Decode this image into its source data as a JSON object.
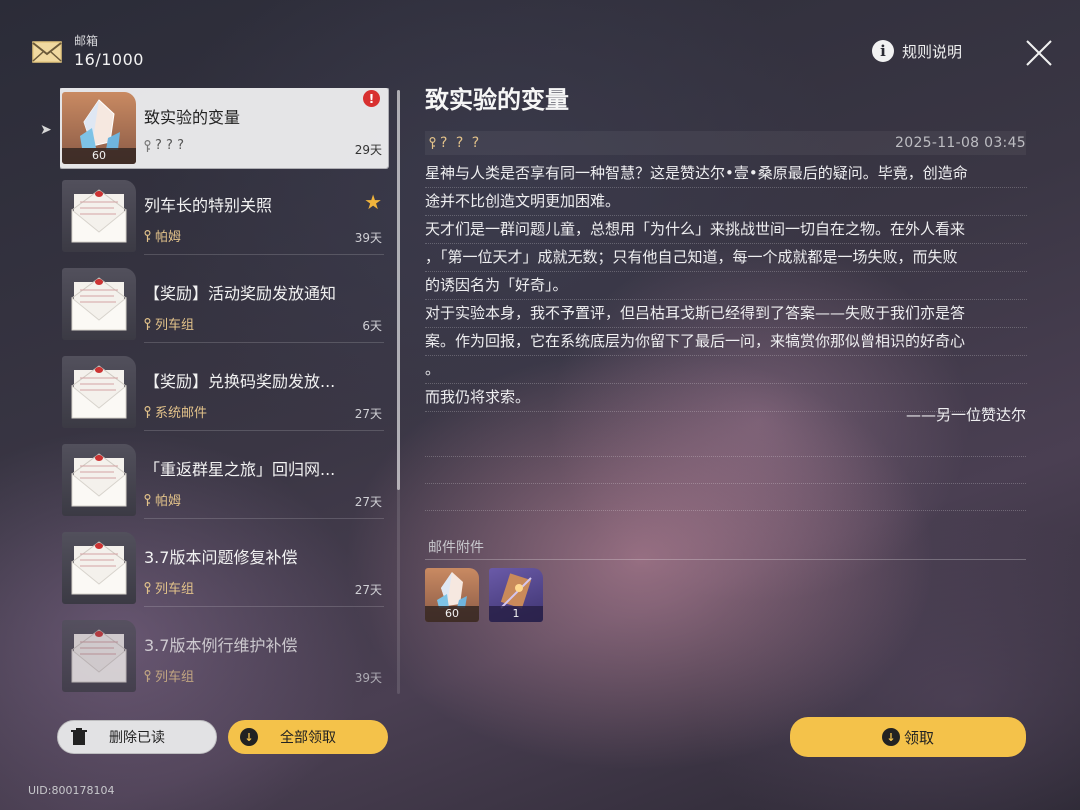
{
  "header": {
    "mailbox_label": "邮箱",
    "mail_count": "16/1000",
    "rules_label": "规则说明",
    "icons": [
      "mail-icon",
      "info-icon",
      "close-icon"
    ]
  },
  "mail_list": [
    {
      "title": "致实验的变量",
      "sender": "? ? ?",
      "days": "29天",
      "qty": "60",
      "thumb": "crystal",
      "marker": "alert"
    },
    {
      "title": "列车长的特别关照",
      "sender": "帕姆",
      "days": "39天",
      "thumb": "envelope",
      "marker": "star"
    },
    {
      "title": "【奖励】活动奖励发放通知",
      "sender": "列车组",
      "days": "6天",
      "thumb": "envelope"
    },
    {
      "title": "【奖励】兑换码奖励发放...",
      "sender": "系统邮件",
      "days": "27天",
      "thumb": "envelope"
    },
    {
      "title": "「重返群星之旅」回归网...",
      "sender": "帕姆",
      "days": "27天",
      "thumb": "envelope"
    },
    {
      "title": "3.7版本问题修复补偿",
      "sender": "列车组",
      "days": "27天",
      "thumb": "envelope"
    },
    {
      "title": "3.7版本例行维护补偿",
      "sender": "列车组",
      "days": "39天",
      "thumb": "envelope"
    }
  ],
  "buttons": {
    "delete_read": "删除已读",
    "claim_all": "全部领取",
    "claim": "领取"
  },
  "uid": "UID:800178104",
  "detail": {
    "title": "致实验的变量",
    "sender": "? ? ?",
    "date": "2025-11-08 03:45",
    "body_lines": [
      "星神与人类是否享有同一种智慧？这是赞达尔•壹•桑原最后的疑问。毕竟，创造命",
      "途并不比创造文明更加困难。",
      "天才们是一群问题儿童，总想用「为什么」来挑战世间一切自在之物。在外人看来",
      "，「第一位天才」成就无数；只有他自己知道，每一个成就都是一场失败，而失败",
      "的诱因名为「好奇」。",
      "对于实验本身，我不予置评，但吕枯耳戈斯已经得到了答案——失败于我们亦是答",
      "案。作为回报，它在系统底层为你留下了最后一问，来犒赏你那似曾相识的好奇心",
      "。",
      "而我仍将求索。"
    ],
    "signature": "——另一位赞达尔",
    "attachments_label": "邮件附件",
    "attachments": [
      {
        "name": "crystal",
        "qty": "60"
      },
      {
        "name": "light-cone",
        "qty": "1"
      }
    ]
  },
  "colors": {
    "accent": "#f4c24a",
    "alert": "#d83030",
    "sender": "#e2c28a"
  }
}
